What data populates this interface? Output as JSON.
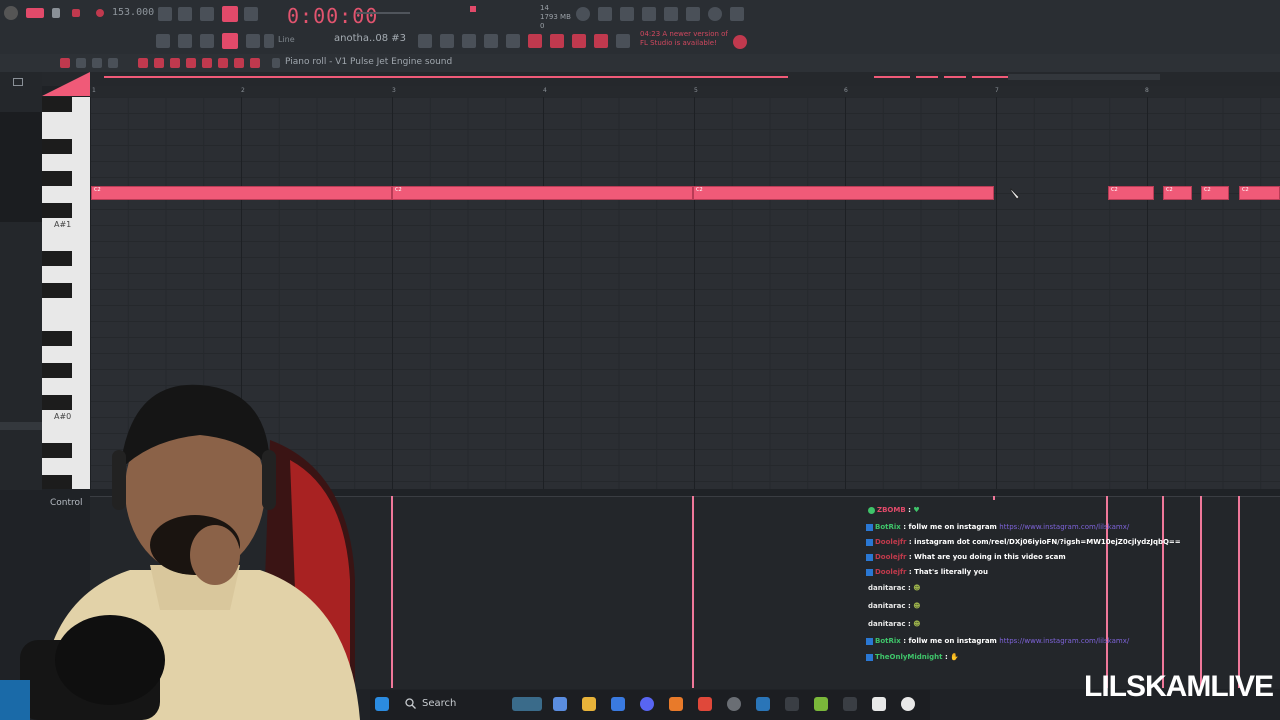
{
  "toolbar": {
    "tempo": "153.000",
    "time": "0:00:00",
    "cpu_line1": "14",
    "cpu_line2": "1793 MB",
    "cpu_line3": "0",
    "pattern": "anotha..08 #3",
    "snap": "Line",
    "news_line1": "04:23 A newer version of",
    "news_line2": "FL Studio is available!"
  },
  "piano_roll": {
    "title": "Piano roll - V1 Pulse Jet Engine sound",
    "bars": [
      "1",
      "2",
      "3",
      "4",
      "5",
      "6",
      "7",
      "8"
    ],
    "key_labels": [
      "A#1",
      "A#0"
    ],
    "note_label": "C2",
    "control_label": "Control"
  },
  "chat": {
    "lines": [
      {
        "user": "ZBOMB",
        "msg": ""
      },
      {
        "user": "BotRix",
        "msg": "follw me on instagram",
        "link": "https://www.instagram.com/lilskamx/"
      },
      {
        "user": "Doolejfr",
        "msg": "instagram dot com/reel/DXj06iyioFN/?igsh=MW10ejZ0cjlydzJqbQ=="
      },
      {
        "user": "Doolejfr",
        "msg": "What are you doing in this video scam"
      },
      {
        "user": "Doolejfr",
        "msg": "That's literally you"
      },
      {
        "user": "danitarac",
        "msg": ""
      },
      {
        "user": "danitarac",
        "msg": ""
      },
      {
        "user": "danitarac",
        "msg": ""
      },
      {
        "user": "BotRix",
        "msg": "follw me on instagram",
        "link": "https://www.instagram.com/lilskamx/"
      },
      {
        "user": "TheOnlyMidnight",
        "msg": ""
      }
    ]
  },
  "taskbar": {
    "search_label": "Search"
  },
  "watermark": "LILSKAMLIVE",
  "colors": {
    "accent": "#f05a78",
    "chat_name": "#3fc46a",
    "link": "#7d63d8"
  }
}
